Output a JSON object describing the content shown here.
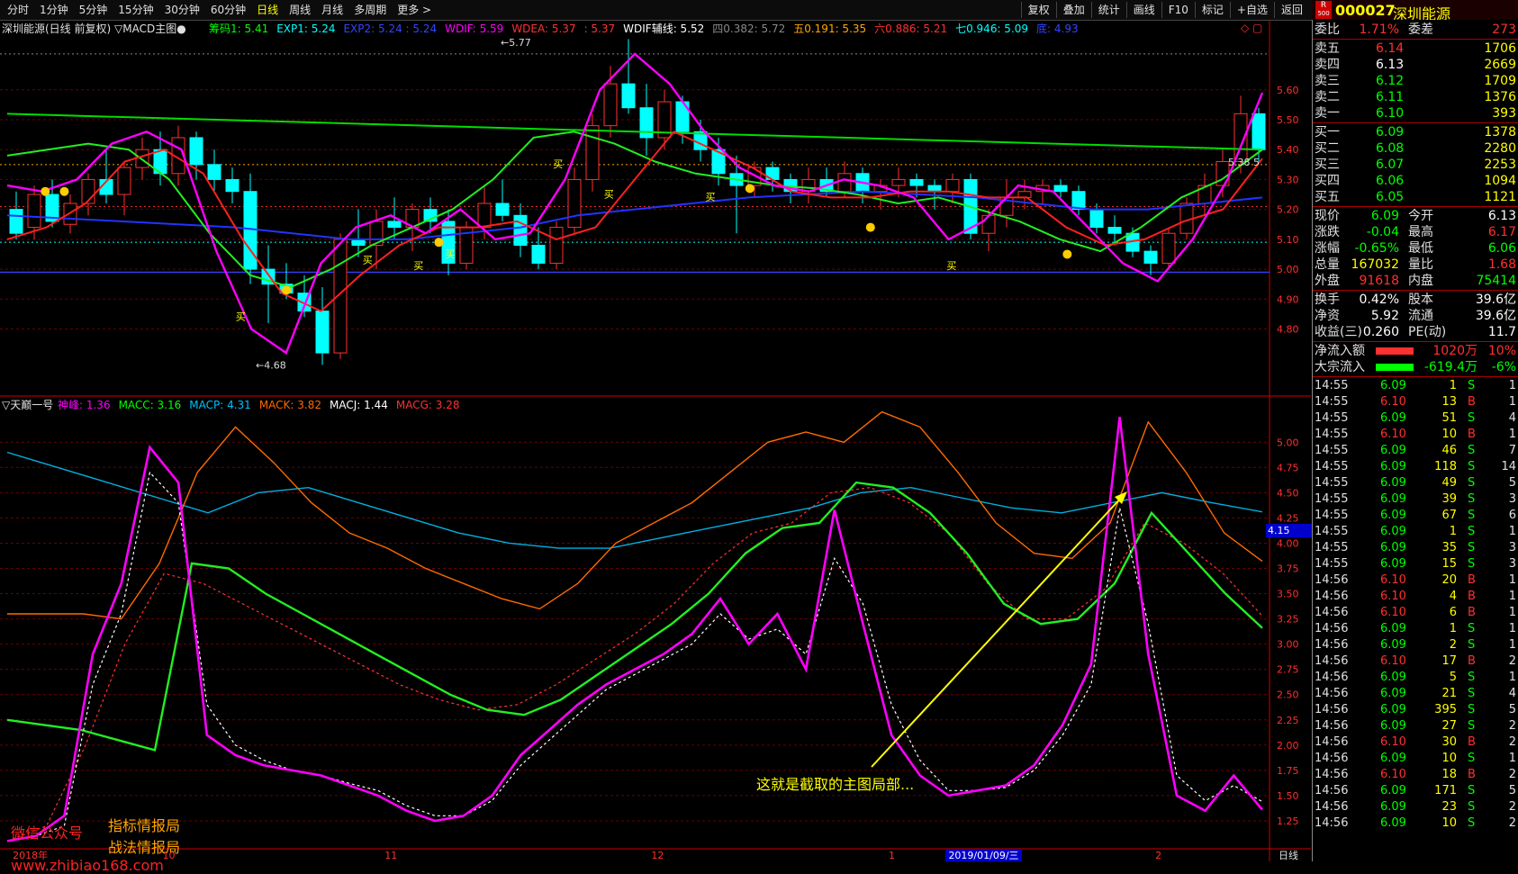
{
  "toolbar": {
    "periods": [
      "分时",
      "1分钟",
      "5分钟",
      "15分钟",
      "30分钟",
      "60分钟",
      "日线",
      "周线",
      "月线",
      "多周期",
      "更多 >"
    ],
    "active_index": 6,
    "tools": [
      "复权",
      "叠加",
      "统计",
      "画线",
      "F10",
      "标记",
      "+自选",
      "返回"
    ]
  },
  "stock": {
    "code": "000027",
    "name": "深圳能源",
    "badge_r": "R",
    "badge_num": "500"
  },
  "main_chart": {
    "title": "深圳能源(日线 前复权) ▽MACD主图●",
    "indicators": [
      {
        "text": "筹码1: 5.41",
        "color": "#00ff00"
      },
      {
        "text": "EXP1: 5.24",
        "color": "#00ffff"
      },
      {
        "text": "EXP2: 5.24 : 5.24",
        "color": "#3344ff"
      },
      {
        "text": "WDIF: 5.59",
        "color": "#ff00ff"
      },
      {
        "text": "WDEA: 5.37",
        "color": "#ff3030"
      },
      {
        "text": ": 5.37",
        "color": "#ff3030"
      },
      {
        "text": "WDIF辅线: 5.52",
        "color": "#ffffff"
      },
      {
        "text": "四0.382: 5.72",
        "color": "#888888"
      },
      {
        "text": "五0.191: 5.35",
        "color": "#ffa500"
      },
      {
        "text": "六0.886: 5.21",
        "color": "#ff3030"
      },
      {
        "text": "七0.946: 5.09",
        "color": "#00ffff"
      },
      {
        "text": "底: 4.93",
        "color": "#3344ff"
      }
    ],
    "price_axis": [
      "5.60",
      "5.50",
      "5.40",
      "5.30",
      "5.20",
      "5.10",
      "5.00",
      "4.90",
      "4.80"
    ],
    "price_axis_values": [
      5.6,
      5.5,
      5.4,
      5.3,
      5.2,
      5.1,
      5.0,
      4.9,
      4.8
    ],
    "high_marker": "5.77",
    "low_marker": "4.68",
    "last_marker": "5.38  5",
    "buy_label": "买",
    "candles": [
      [
        5.2,
        5.26,
        5.1,
        5.12
      ],
      [
        5.14,
        5.28,
        5.1,
        5.25
      ],
      [
        5.25,
        5.3,
        5.14,
        5.16
      ],
      [
        5.15,
        5.25,
        5.12,
        5.22
      ],
      [
        5.22,
        5.32,
        5.18,
        5.3
      ],
      [
        5.3,
        5.4,
        5.22,
        5.25
      ],
      [
        5.25,
        5.36,
        5.18,
        5.34
      ],
      [
        5.34,
        5.44,
        5.3,
        5.4
      ],
      [
        5.4,
        5.46,
        5.28,
        5.32
      ],
      [
        5.32,
        5.48,
        5.28,
        5.44
      ],
      [
        5.44,
        5.46,
        5.3,
        5.35
      ],
      [
        5.35,
        5.4,
        5.26,
        5.3
      ],
      [
        5.3,
        5.34,
        5.22,
        5.26
      ],
      [
        5.26,
        5.32,
        4.95,
        5.0
      ],
      [
        5.0,
        5.08,
        4.82,
        4.95
      ],
      [
        4.95,
        5.02,
        4.9,
        4.92
      ],
      [
        4.92,
        4.98,
        4.84,
        4.86
      ],
      [
        4.86,
        4.94,
        4.68,
        4.72
      ],
      [
        4.72,
        5.12,
        4.7,
        5.1
      ],
      [
        5.1,
        5.2,
        5.04,
        5.08
      ],
      [
        5.08,
        5.2,
        5.0,
        5.16
      ],
      [
        5.16,
        5.24,
        5.1,
        5.14
      ],
      [
        5.14,
        5.22,
        5.06,
        5.2
      ],
      [
        5.2,
        5.24,
        5.12,
        5.16
      ],
      [
        5.16,
        5.2,
        4.98,
        5.02
      ],
      [
        5.02,
        5.16,
        5.0,
        5.14
      ],
      [
        5.14,
        5.28,
        5.1,
        5.22
      ],
      [
        5.22,
        5.3,
        5.16,
        5.18
      ],
      [
        5.18,
        5.22,
        5.04,
        5.08
      ],
      [
        5.08,
        5.14,
        5.0,
        5.02
      ],
      [
        5.02,
        5.16,
        5.0,
        5.14
      ],
      [
        5.14,
        5.34,
        5.12,
        5.3
      ],
      [
        5.3,
        5.52,
        5.26,
        5.48
      ],
      [
        5.48,
        5.68,
        5.44,
        5.62
      ],
      [
        5.62,
        5.77,
        5.52,
        5.54
      ],
      [
        5.54,
        5.62,
        5.38,
        5.44
      ],
      [
        5.44,
        5.6,
        5.4,
        5.56
      ],
      [
        5.56,
        5.58,
        5.42,
        5.46
      ],
      [
        5.46,
        5.5,
        5.36,
        5.4
      ],
      [
        5.4,
        5.44,
        5.28,
        5.32
      ],
      [
        5.32,
        5.38,
        5.12,
        5.28
      ],
      [
        5.28,
        5.36,
        5.24,
        5.34
      ],
      [
        5.34,
        5.36,
        5.26,
        5.3
      ],
      [
        5.3,
        5.32,
        5.22,
        5.26
      ],
      [
        5.26,
        5.34,
        5.22,
        5.3
      ],
      [
        5.3,
        5.34,
        5.24,
        5.26
      ],
      [
        5.26,
        5.36,
        5.24,
        5.32
      ],
      [
        5.32,
        5.34,
        5.22,
        5.26
      ],
      [
        5.26,
        5.3,
        5.2,
        5.28
      ],
      [
        5.28,
        5.34,
        5.24,
        5.3
      ],
      [
        5.3,
        5.32,
        5.24,
        5.28
      ],
      [
        5.28,
        5.3,
        5.2,
        5.26
      ],
      [
        5.26,
        5.32,
        5.22,
        5.3
      ],
      [
        5.3,
        5.32,
        5.1,
        5.12
      ],
      [
        5.12,
        5.2,
        5.06,
        5.18
      ],
      [
        5.18,
        5.3,
        5.14,
        5.24
      ],
      [
        5.24,
        5.3,
        5.2,
        5.26
      ],
      [
        5.26,
        5.3,
        5.22,
        5.28
      ],
      [
        5.28,
        5.3,
        5.24,
        5.26
      ],
      [
        5.26,
        5.28,
        5.18,
        5.2
      ],
      [
        5.2,
        5.22,
        5.12,
        5.14
      ],
      [
        5.14,
        5.18,
        5.08,
        5.12
      ],
      [
        5.12,
        5.14,
        5.04,
        5.06
      ],
      [
        5.06,
        5.08,
        4.98,
        5.02
      ],
      [
        5.02,
        5.14,
        5.0,
        5.12
      ],
      [
        5.12,
        5.24,
        5.1,
        5.22
      ],
      [
        5.22,
        5.32,
        5.18,
        5.28
      ],
      [
        5.28,
        5.4,
        5.24,
        5.36
      ],
      [
        5.36,
        5.58,
        5.32,
        5.52
      ],
      [
        5.52,
        5.54,
        5.36,
        5.4
      ]
    ],
    "lines": {
      "green_long": [
        5.52,
        5.51,
        5.5,
        5.49,
        5.48,
        5.47,
        5.46,
        5.45,
        5.44,
        5.43,
        5.42,
        5.41,
        5.4
      ],
      "green_mid": [
        5.38,
        5.4,
        5.42,
        5.4,
        5.3,
        5.12,
        4.98,
        4.94,
        5.0,
        5.08,
        5.14,
        5.2,
        5.3,
        5.44,
        5.46,
        5.42,
        5.36,
        5.32,
        5.3,
        5.28,
        5.27,
        5.25,
        5.22,
        5.24,
        5.2,
        5.16,
        5.1,
        5.06,
        5.14,
        5.24,
        5.3,
        5.4
      ],
      "magenta": [
        5.28,
        5.26,
        5.3,
        5.42,
        5.46,
        5.4,
        5.06,
        4.8,
        4.72,
        5.02,
        5.14,
        5.18,
        5.12,
        5.2,
        5.1,
        5.12,
        5.3,
        5.6,
        5.72,
        5.62,
        5.46,
        5.34,
        5.28,
        5.26,
        5.3,
        5.28,
        5.24,
        5.1,
        5.16,
        5.28,
        5.26,
        5.14,
        5.02,
        4.96,
        5.1,
        5.3,
        5.59
      ],
      "red": [
        5.1,
        5.14,
        5.22,
        5.36,
        5.4,
        5.32,
        5.1,
        4.92,
        4.86,
        4.98,
        5.08,
        5.14,
        5.14,
        5.16,
        5.1,
        5.14,
        5.3,
        5.46,
        5.4,
        5.34,
        5.26,
        5.24,
        5.24,
        5.26,
        5.26,
        5.24,
        5.24,
        5.14,
        5.08,
        5.1,
        5.16,
        5.2,
        5.37
      ],
      "blue": [
        5.18,
        5.17,
        5.16,
        5.15,
        5.14,
        5.12,
        5.1,
        5.1,
        5.12,
        5.14,
        5.18,
        5.2,
        5.22,
        5.24,
        5.25,
        5.26,
        5.25,
        5.24,
        5.22,
        5.2,
        5.2,
        5.22,
        5.24
      ]
    },
    "bottom_line_value": 4.99
  },
  "sub_chart": {
    "title": "▽天巅一号",
    "indicators": [
      {
        "text": "神峰: 1.36",
        "color": "#ff00ff"
      },
      {
        "text": "MACC: 3.16",
        "color": "#00ff00"
      },
      {
        "text": "MACP: 4.31",
        "color": "#00c0ff"
      },
      {
        "text": "MACK: 3.82",
        "color": "#ff6600"
      },
      {
        "text": "MACJ: 1.44",
        "color": "#ffffff"
      },
      {
        "text": "MACG: 3.28",
        "color": "#ff3030"
      }
    ],
    "axis": [
      "5.00",
      "4.75",
      "4.50",
      "4.25",
      "4.00",
      "3.75",
      "3.50",
      "3.25",
      "3.00",
      "2.75",
      "2.50",
      "2.25",
      "2.00",
      "1.75",
      "1.50",
      "1.25"
    ],
    "axis_values": [
      5.0,
      4.75,
      4.5,
      4.25,
      4.0,
      3.75,
      3.5,
      3.25,
      3.0,
      2.75,
      2.5,
      2.25,
      2.0,
      1.75,
      1.5,
      1.25
    ],
    "current_value_box": "4.15",
    "annotation": "这就是截取的主图局部...",
    "series": {
      "magenta": [
        1.05,
        1.1,
        1.3,
        2.9,
        3.6,
        4.95,
        4.6,
        2.1,
        1.9,
        1.8,
        1.75,
        1.7,
        1.6,
        1.5,
        1.35,
        1.25,
        1.3,
        1.5,
        1.9,
        2.15,
        2.4,
        2.6,
        2.75,
        2.9,
        3.1,
        3.45,
        3.0,
        3.3,
        2.75,
        4.33,
        3.2,
        2.1,
        1.7,
        1.5,
        1.55,
        1.6,
        1.8,
        2.2,
        2.8,
        5.25,
        2.9,
        1.5,
        1.35,
        1.7,
        1.36
      ],
      "white": [
        1.05,
        1.1,
        1.2,
        2.6,
        3.3,
        4.7,
        4.4,
        2.4,
        2.0,
        1.85,
        1.75,
        1.7,
        1.62,
        1.55,
        1.4,
        1.3,
        1.3,
        1.45,
        1.8,
        2.05,
        2.3,
        2.55,
        2.7,
        2.85,
        3.0,
        3.3,
        3.05,
        3.15,
        2.9,
        3.85,
        3.4,
        2.4,
        1.85,
        1.55,
        1.55,
        1.58,
        1.75,
        2.1,
        2.6,
        4.35,
        3.2,
        1.7,
        1.45,
        1.6,
        1.44
      ],
      "green": [
        2.25,
        2.2,
        2.15,
        2.05,
        1.95,
        3.8,
        3.75,
        3.5,
        3.3,
        3.1,
        2.9,
        2.7,
        2.5,
        2.35,
        2.3,
        2.45,
        2.7,
        2.95,
        3.2,
        3.5,
        3.9,
        4.15,
        4.2,
        4.6,
        4.55,
        4.3,
        3.9,
        3.4,
        3.2,
        3.25,
        3.6,
        4.3,
        3.9,
        3.5,
        3.16
      ],
      "red_dash": [
        1.05,
        1.2,
        2.0,
        3.0,
        3.7,
        3.6,
        3.4,
        3.2,
        3.0,
        2.8,
        2.6,
        2.45,
        2.35,
        2.4,
        2.6,
        2.85,
        3.1,
        3.4,
        3.8,
        4.1,
        4.2,
        4.5,
        4.55,
        4.4,
        4.1,
        3.6,
        3.25,
        3.25,
        3.55,
        4.2,
        4.0,
        3.7,
        3.28
      ],
      "orange": [
        3.3,
        3.3,
        3.3,
        3.25,
        3.8,
        4.7,
        5.15,
        4.8,
        4.4,
        4.1,
        3.95,
        3.75,
        3.6,
        3.45,
        3.35,
        3.6,
        4.0,
        4.2,
        4.4,
        4.7,
        5.0,
        5.1,
        5.0,
        5.3,
        5.15,
        4.7,
        4.2,
        3.9,
        3.85,
        4.2,
        5.2,
        4.7,
        4.1,
        3.82
      ],
      "cyan": [
        4.9,
        4.75,
        4.6,
        4.45,
        4.3,
        4.5,
        4.55,
        4.4,
        4.25,
        4.1,
        4.0,
        3.95,
        3.95,
        4.05,
        4.15,
        4.25,
        4.35,
        4.5,
        4.55,
        4.45,
        4.35,
        4.3,
        4.4,
        4.5,
        4.4,
        4.31
      ]
    }
  },
  "x_axis": [
    {
      "text": "2018年",
      "pos": 0.01,
      "color": "#ff3030"
    },
    {
      "text": "10",
      "pos": 0.128,
      "color": "#ff3030"
    },
    {
      "text": "11",
      "pos": 0.303,
      "color": "#ff3030"
    },
    {
      "text": "12",
      "pos": 0.513,
      "color": "#ff3030"
    },
    {
      "text": "1",
      "pos": 0.7,
      "color": "#ff3030"
    },
    {
      "text": "2019/01/09/三",
      "pos": 0.745,
      "color": "#ffffff",
      "highlight": true
    },
    {
      "text": "2",
      "pos": 0.91,
      "color": "#ff3030"
    }
  ],
  "x_axis_right_label": "日线",
  "watermark": {
    "line1": "微信公众号",
    "bracket1": "指标情报局",
    "bracket2": "战法情报局",
    "url": "www.zhibiao168.com"
  },
  "quote": {
    "rows": [
      {
        "l": "委比",
        "v": "1.71%",
        "vc": "#ff3030",
        "l2": "委差",
        "v2": "273",
        "v2c": "#ff3030"
      }
    ],
    "sell": [
      {
        "l": "卖五",
        "p": "6.14",
        "pc": "#ff3030",
        "v": "1706"
      },
      {
        "l": "卖四",
        "p": "6.13",
        "pc": "#ffffff",
        "v": "2669"
      },
      {
        "l": "卖三",
        "p": "6.12",
        "pc": "#00ff00",
        "v": "1709"
      },
      {
        "l": "卖二",
        "p": "6.11",
        "pc": "#00ff00",
        "v": "1376"
      },
      {
        "l": "卖一",
        "p": "6.10",
        "pc": "#00ff00",
        "v": "393"
      }
    ],
    "buy": [
      {
        "l": "买一",
        "p": "6.09",
        "pc": "#00ff00",
        "v": "1378"
      },
      {
        "l": "买二",
        "p": "6.08",
        "pc": "#00ff00",
        "v": "2280"
      },
      {
        "l": "买三",
        "p": "6.07",
        "pc": "#00ff00",
        "v": "2253"
      },
      {
        "l": "买四",
        "p": "6.06",
        "pc": "#00ff00",
        "v": "1094"
      },
      {
        "l": "买五",
        "p": "6.05",
        "pc": "#00ff00",
        "v": "1121"
      }
    ],
    "stats1": [
      {
        "l": "现价",
        "v": "6.09",
        "vc": "#00ff00",
        "l2": "今开",
        "v2": "6.13",
        "v2c": "#ffffff"
      },
      {
        "l": "涨跌",
        "v": "-0.04",
        "vc": "#00ff00",
        "l2": "最高",
        "v2": "6.17",
        "v2c": "#ff3030"
      },
      {
        "l": "涨幅",
        "v": "-0.65%",
        "vc": "#00ff00",
        "l2": "最低",
        "v2": "6.06",
        "v2c": "#00ff00"
      },
      {
        "l": "总量",
        "v": "167032",
        "vc": "#ffff00",
        "l2": "量比",
        "v2": "1.68",
        "v2c": "#ff3030"
      },
      {
        "l": "外盘",
        "v": "91618",
        "vc": "#ff3030",
        "l2": "内盘",
        "v2": "75414",
        "v2c": "#00ff00"
      }
    ],
    "stats2": [
      {
        "l": "换手",
        "v": "0.42%",
        "vc": "#ffffff",
        "l2": "股本",
        "v2": "39.6亿",
        "v2c": "#ffffff"
      },
      {
        "l": "净资",
        "v": "5.92",
        "vc": "#ffffff",
        "l2": "流通",
        "v2": "39.6亿",
        "v2c": "#ffffff"
      },
      {
        "l": "收益(三)",
        "v": "0.260",
        "vc": "#ffffff",
        "l2": "PE(动)",
        "v2": "11.7",
        "v2c": "#ffffff"
      }
    ],
    "flow": [
      {
        "l": "净流入额",
        "v": "1020万",
        "pct": "10%",
        "bar": "#ff3030",
        "vc": "#ff3030"
      },
      {
        "l": "大宗流入",
        "v": "-619.4万",
        "pct": "-6%",
        "bar": "#00ff00",
        "vc": "#00ff00"
      }
    ],
    "ticks": [
      [
        "14:55",
        "6.09",
        "1",
        "S",
        "1"
      ],
      [
        "14:55",
        "6.10",
        "13",
        "B",
        "1"
      ],
      [
        "14:55",
        "6.09",
        "51",
        "S",
        "4"
      ],
      [
        "14:55",
        "6.10",
        "10",
        "B",
        "1"
      ],
      [
        "14:55",
        "6.09",
        "46",
        "S",
        "7"
      ],
      [
        "14:55",
        "6.09",
        "118",
        "S",
        "14"
      ],
      [
        "14:55",
        "6.09",
        "49",
        "S",
        "5"
      ],
      [
        "14:55",
        "6.09",
        "39",
        "S",
        "3"
      ],
      [
        "14:55",
        "6.09",
        "67",
        "S",
        "6"
      ],
      [
        "14:55",
        "6.09",
        "1",
        "S",
        "1"
      ],
      [
        "14:55",
        "6.09",
        "35",
        "S",
        "3"
      ],
      [
        "14:55",
        "6.09",
        "15",
        "S",
        "3"
      ],
      [
        "14:56",
        "6.10",
        "20",
        "B",
        "1"
      ],
      [
        "14:56",
        "6.10",
        "4",
        "B",
        "1"
      ],
      [
        "14:56",
        "6.10",
        "6",
        "B",
        "1"
      ],
      [
        "14:56",
        "6.09",
        "1",
        "S",
        "1"
      ],
      [
        "14:56",
        "6.09",
        "2",
        "S",
        "1"
      ],
      [
        "14:56",
        "6.10",
        "17",
        "B",
        "2"
      ],
      [
        "14:56",
        "6.09",
        "5",
        "S",
        "1"
      ],
      [
        "14:56",
        "6.09",
        "21",
        "S",
        "4"
      ],
      [
        "14:56",
        "6.09",
        "395",
        "S",
        "5"
      ],
      [
        "14:56",
        "6.09",
        "27",
        "S",
        "2"
      ],
      [
        "14:56",
        "6.10",
        "30",
        "B",
        "2"
      ],
      [
        "14:56",
        "6.09",
        "10",
        "S",
        "1"
      ],
      [
        "14:56",
        "6.10",
        "18",
        "B",
        "2"
      ],
      [
        "14:56",
        "6.09",
        "171",
        "S",
        "5"
      ],
      [
        "14:56",
        "6.09",
        "23",
        "S",
        "2"
      ],
      [
        "14:56",
        "6.09",
        "10",
        "S",
        "2"
      ]
    ]
  },
  "colors": {
    "up": "#ff3030",
    "down": "#00ffff",
    "grid": "#8b0000"
  }
}
